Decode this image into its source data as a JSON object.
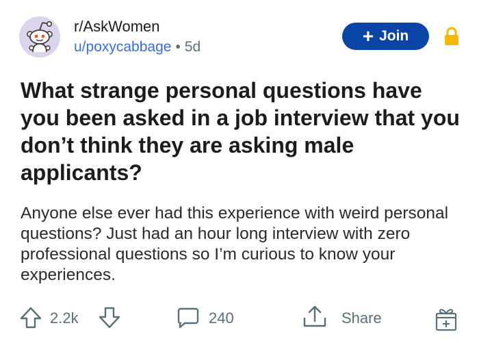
{
  "post": {
    "subreddit": "r/AskWomen",
    "author": "u/poxycabbage",
    "separator": "•",
    "age": "5d",
    "join_label": "Join",
    "title": "What strange personal questions have you been asked in a job interview that you don’t think they are asking male applicants?",
    "body": "Anyone else ever had this experience with weird personal questions? Just had an hour long interview with zero professional questions so I’m curious to know your experiences."
  },
  "actions": {
    "score": "2.2k",
    "comments": "240",
    "share_label": "Share"
  },
  "icons": {
    "avatar": "snoo-avatar-icon",
    "lock": "lock-icon",
    "upvote": "upvote-arrow-icon",
    "downvote": "downvote-arrow-icon",
    "comment": "comment-bubble-icon",
    "share": "share-icon",
    "award": "award-gift-icon"
  },
  "colors": {
    "join_button": "#0a45a6",
    "user_link": "#3c6ed1",
    "lock": "#f5b700",
    "avatar_bg": "#dcd3ec",
    "meta_text": "#576f76"
  }
}
